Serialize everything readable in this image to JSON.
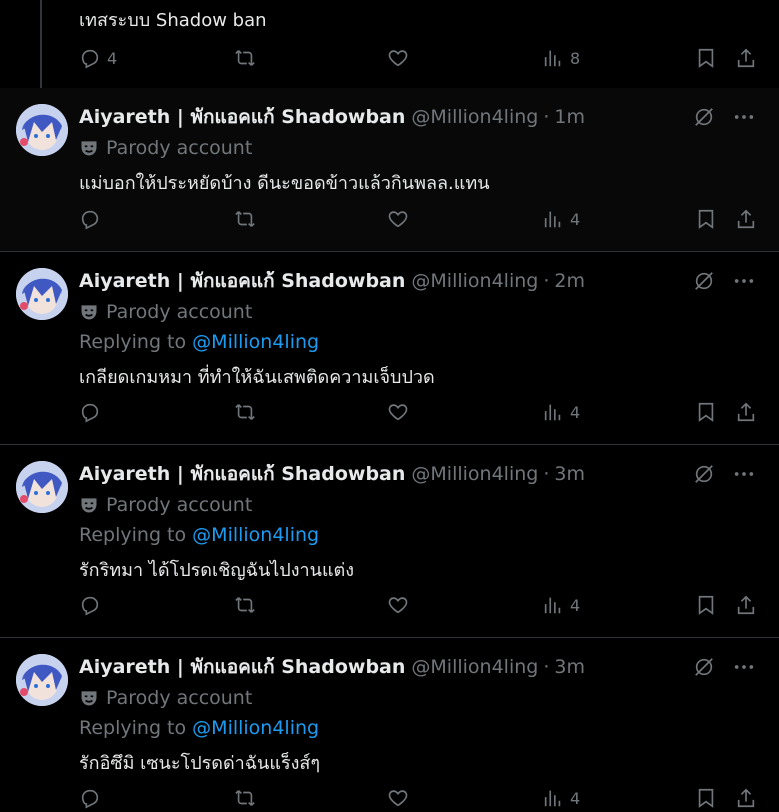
{
  "top": {
    "body": "เทสระบบ Shadow ban",
    "reply_count": "4",
    "views": "8"
  },
  "tweets": [
    {
      "display_name": "Aiyareth | พักแอคแก้ Shadowban",
      "handle": "@Million4ling",
      "time": "1m",
      "badge": "Parody account",
      "replying_label": "",
      "replying_to": "",
      "body": "แม่บอกให้ประหยัดบ้าง ดีนะขอดข้าวแล้วกินพลล.แทน",
      "views": "4"
    },
    {
      "display_name": "Aiyareth | พักแอคแก้ Shadowban",
      "handle": "@Million4ling",
      "time": "2m",
      "badge": "Parody account",
      "replying_label": "Replying to",
      "replying_to": "@Million4ling",
      "body": "เกลียดเกมหมา ที่ทำให้ฉันเสพติดความเจ็บปวด",
      "views": "4"
    },
    {
      "display_name": "Aiyareth | พักแอคแก้ Shadowban",
      "handle": "@Million4ling",
      "time": "3m",
      "badge": "Parody account",
      "replying_label": "Replying to",
      "replying_to": "@Million4ling",
      "body": "รักริทมา ได้โปรดเชิญฉันไปงานแต่ง",
      "views": "4"
    },
    {
      "display_name": "Aiyareth | พักแอคแก้ Shadowban",
      "handle": "@Million4ling",
      "time": "3m",
      "badge": "Parody account",
      "replying_label": "Replying to",
      "replying_to": "@Million4ling",
      "body": "รักอิซึมิ เซนะโปรดด่าฉันแร็งส์ๆ",
      "views": "4"
    }
  ],
  "icons": {
    "reply": "reply-icon",
    "repost": "repost-icon",
    "like": "heart-icon",
    "views": "views-icon",
    "bookmark": "bookmark-icon",
    "share": "share-icon",
    "grok": "grok-icon",
    "more": "more-icon",
    "parody": "parody-mask-icon"
  },
  "colors": {
    "background": "#000000",
    "text": "#e7e9ea",
    "muted": "#71767b",
    "link": "#1d9bf0",
    "divider": "#2f3336"
  }
}
